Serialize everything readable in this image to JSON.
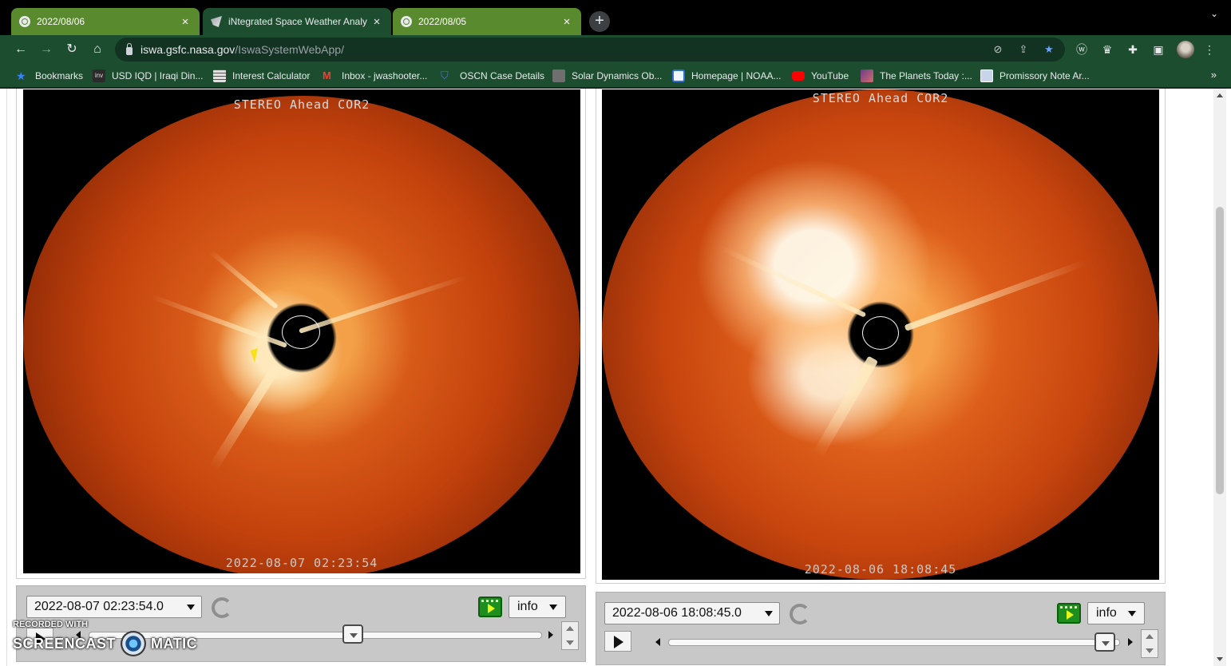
{
  "tabs": [
    {
      "label": "2022/08/06",
      "close": "×"
    },
    {
      "label": "iNtegrated Space Weather Analy",
      "close": "×"
    },
    {
      "label": "2022/08/05",
      "close": "×"
    }
  ],
  "new_tab": "+",
  "toolbar": {
    "back": "←",
    "forward": "→",
    "reload": "↻",
    "home": "⌂",
    "url_host": "iswa.gsfc.nasa.gov",
    "url_path": "/IswaSystemWebApp/"
  },
  "bookmarks": {
    "items": [
      {
        "label": "Bookmarks",
        "icon": "star-icon",
        "color": "#3b82f6"
      },
      {
        "label": "USD IQD | Iraqi Din...",
        "icon": "inv-icon",
        "color": "#9e9e9e"
      },
      {
        "label": "Interest Calculator",
        "icon": "calculator-icon",
        "color": "#d0d0d0"
      },
      {
        "label": "Inbox - jwashooter...",
        "icon": "gmail-icon",
        "color": "#ea4335"
      },
      {
        "label": "OSCN Case Details",
        "icon": "oscn-icon",
        "color": "#4a7bd0"
      },
      {
        "label": "Solar Dynamics Ob...",
        "icon": "sdo-icon",
        "color": "#8a8a8a"
      },
      {
        "label": "Homepage | NOAA...",
        "icon": "noaa-icon",
        "color": "#2f6fd6"
      },
      {
        "label": "YouTube",
        "icon": "youtube-icon",
        "color": "#ff0000"
      },
      {
        "label": "The Planets Today :...",
        "icon": "planets-icon",
        "color": "#8a5a9a"
      },
      {
        "label": "Promissory Note Ar...",
        "icon": "document-icon",
        "color": "#c8d4e8"
      }
    ],
    "more": "»"
  },
  "left_panel": {
    "instrument": "STEREO Ahead COR2",
    "image_time": "2022-08-07 02:23:54",
    "timestamp_select": "2022-08-07 02:23:54.0",
    "info_label": "info"
  },
  "right_panel": {
    "instrument": "STEREO Ahead COR2",
    "image_time": "2022-08-06 18:08:45",
    "timestamp_select": "2022-08-06 18:08:45.0",
    "info_label": "info"
  },
  "watermark": {
    "line1": "RECORDED WITH",
    "word1": "SCREENCAST",
    "word2": "MATIC"
  }
}
